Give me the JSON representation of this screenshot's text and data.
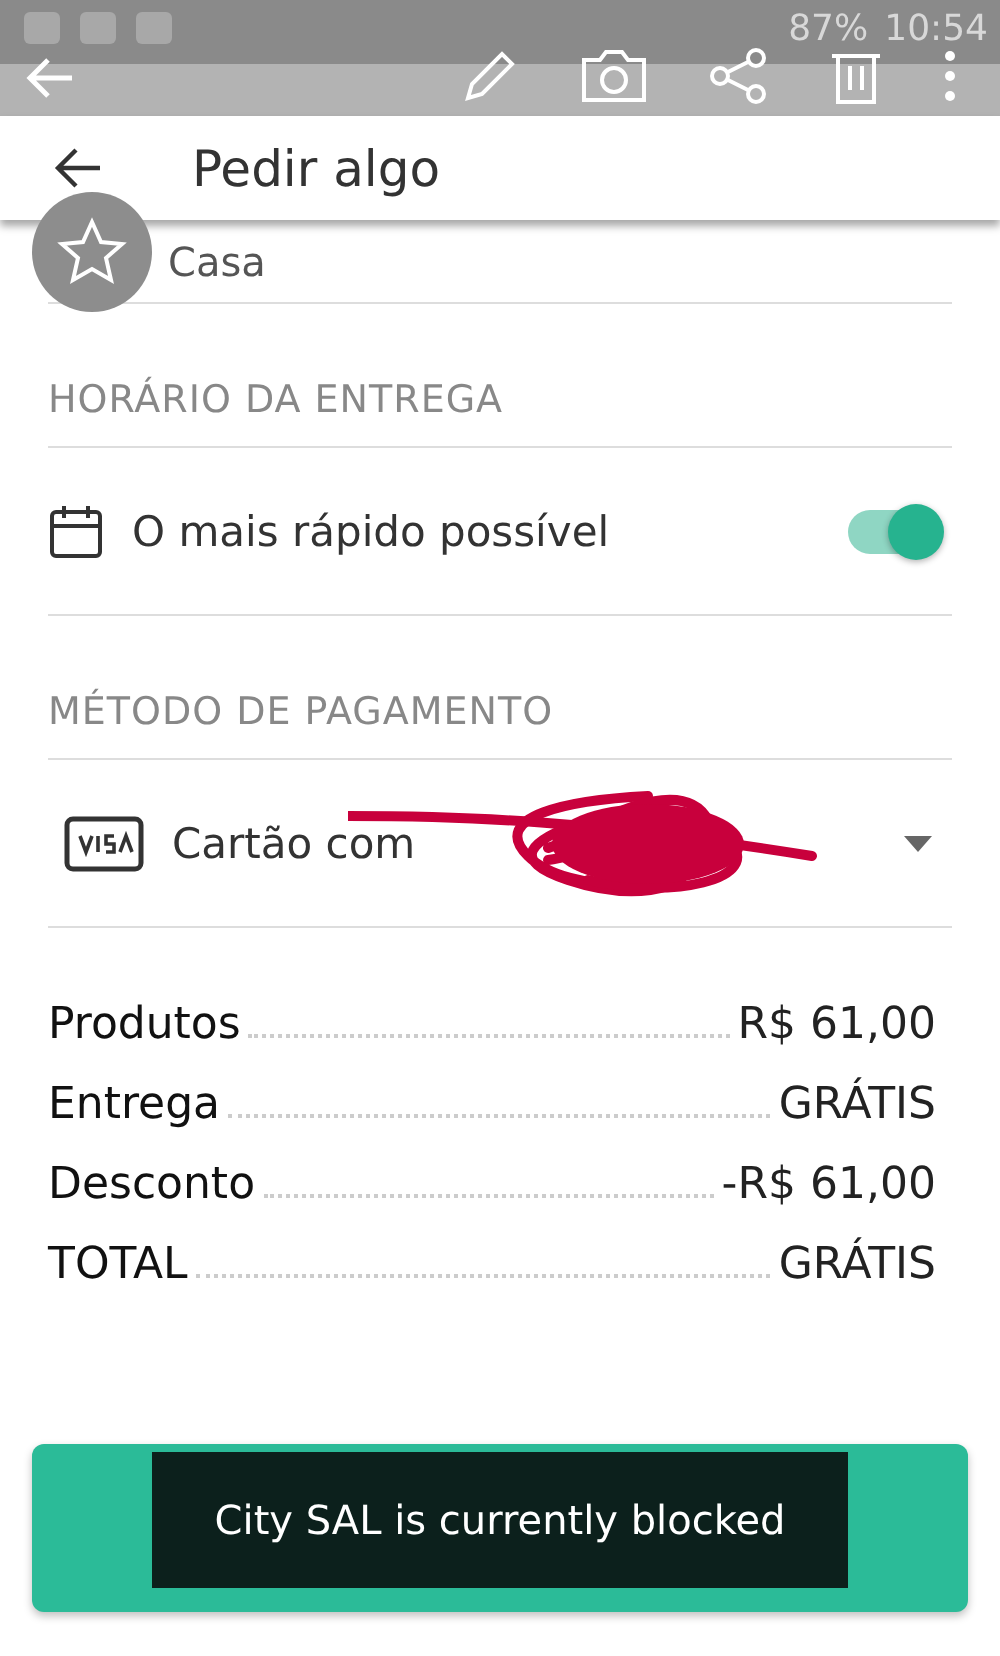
{
  "status_bar": {
    "battery": "87%",
    "time": "10:54"
  },
  "app_bar": {
    "title": "Pedir algo"
  },
  "address": {
    "label": "Casa"
  },
  "delivery_time": {
    "heading": "HORÁRIO DA ENTREGA",
    "option": "O mais rápido possível",
    "on": true
  },
  "payment": {
    "heading": "MÉTODO DE PAGAMENTO",
    "method": "Cartão com"
  },
  "summary": [
    {
      "label": "Produtos",
      "value": "R$ 61,00"
    },
    {
      "label": "Entrega",
      "value": "GRÁTIS"
    },
    {
      "label": "Desconto",
      "value": "-R$ 61,00"
    },
    {
      "label": "TOTAL",
      "value": "GRÁTIS"
    }
  ],
  "toast": "City SAL is currently blocked"
}
